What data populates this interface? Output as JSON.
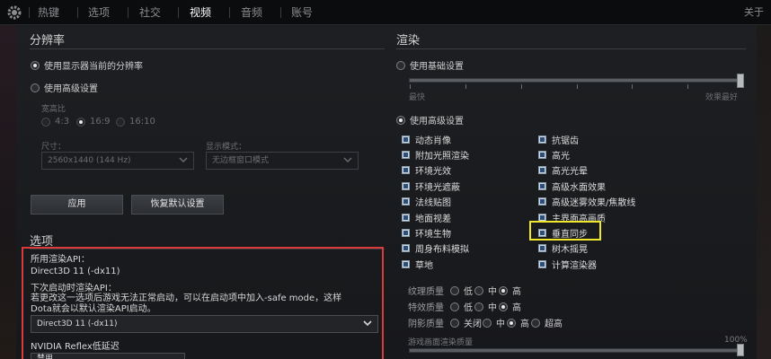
{
  "nav": {
    "tabs": [
      "热键",
      "选项",
      "社交",
      "视频",
      "音频",
      "账号"
    ],
    "active_tab": "视频",
    "about": "关于"
  },
  "resolution": {
    "title": "分辨率",
    "use_current": "使用显示器当前的分辨率",
    "use_advanced": "使用高级设置",
    "aspect_label": "宽高比",
    "aspects": [
      "4:3",
      "16:9",
      "16:10"
    ],
    "size_label": "尺寸：",
    "size_value": "2560x1440 (144 Hz)",
    "mode_label": "显示模式：",
    "mode_value": "无边框窗口模式",
    "apply": "应用",
    "restore": "恢复默认设置"
  },
  "options": {
    "title": "选项",
    "render_api_label": "所用渲染API：",
    "render_api_value": "Direct3D 11 (-dx11)",
    "next_api_label": "下次启动时渲染API：",
    "next_api_note_1": "若更改这一选项后游戏无法正常启动，可以在启动项中加入-safe mode，这样",
    "next_api_note_2": "Dota就会以默认渲染API启动。",
    "api_select": "Direct3D 11 (-dx11)",
    "reflex_label": "NVIDIA Reflex低延迟",
    "reflex_value": "禁用"
  },
  "render": {
    "title": "渲染",
    "basic": "使用基础设置",
    "slider_left": "最快",
    "slider_right": "效果最好",
    "advanced": "使用高级设置",
    "left_checks": [
      "动态肖像",
      "附加光照渲染",
      "环境光效",
      "环境光遮蔽",
      "法线贴图",
      "地面视差",
      "环境生物",
      "周身布料模拟",
      "草地"
    ],
    "right_checks": [
      "抗锯齿",
      "高光",
      "高光光晕",
      "高级水面效果",
      "高级迷雾效果/焦散线",
      "主界面高画质",
      "垂直同步",
      "树木摇晃",
      "计算渲染器"
    ],
    "texture_label": "纹理质量",
    "texture_opts": [
      "低",
      "中",
      "高"
    ],
    "effects_label": "特效质量",
    "effects_opts": [
      "低",
      "中",
      "高"
    ],
    "shadow_label": "阴影质量",
    "shadow_opts": [
      "关闭",
      "中",
      "高",
      "超高"
    ],
    "render_scale_label": "游戏画面渲染质量",
    "render_scale_value": "100%"
  }
}
